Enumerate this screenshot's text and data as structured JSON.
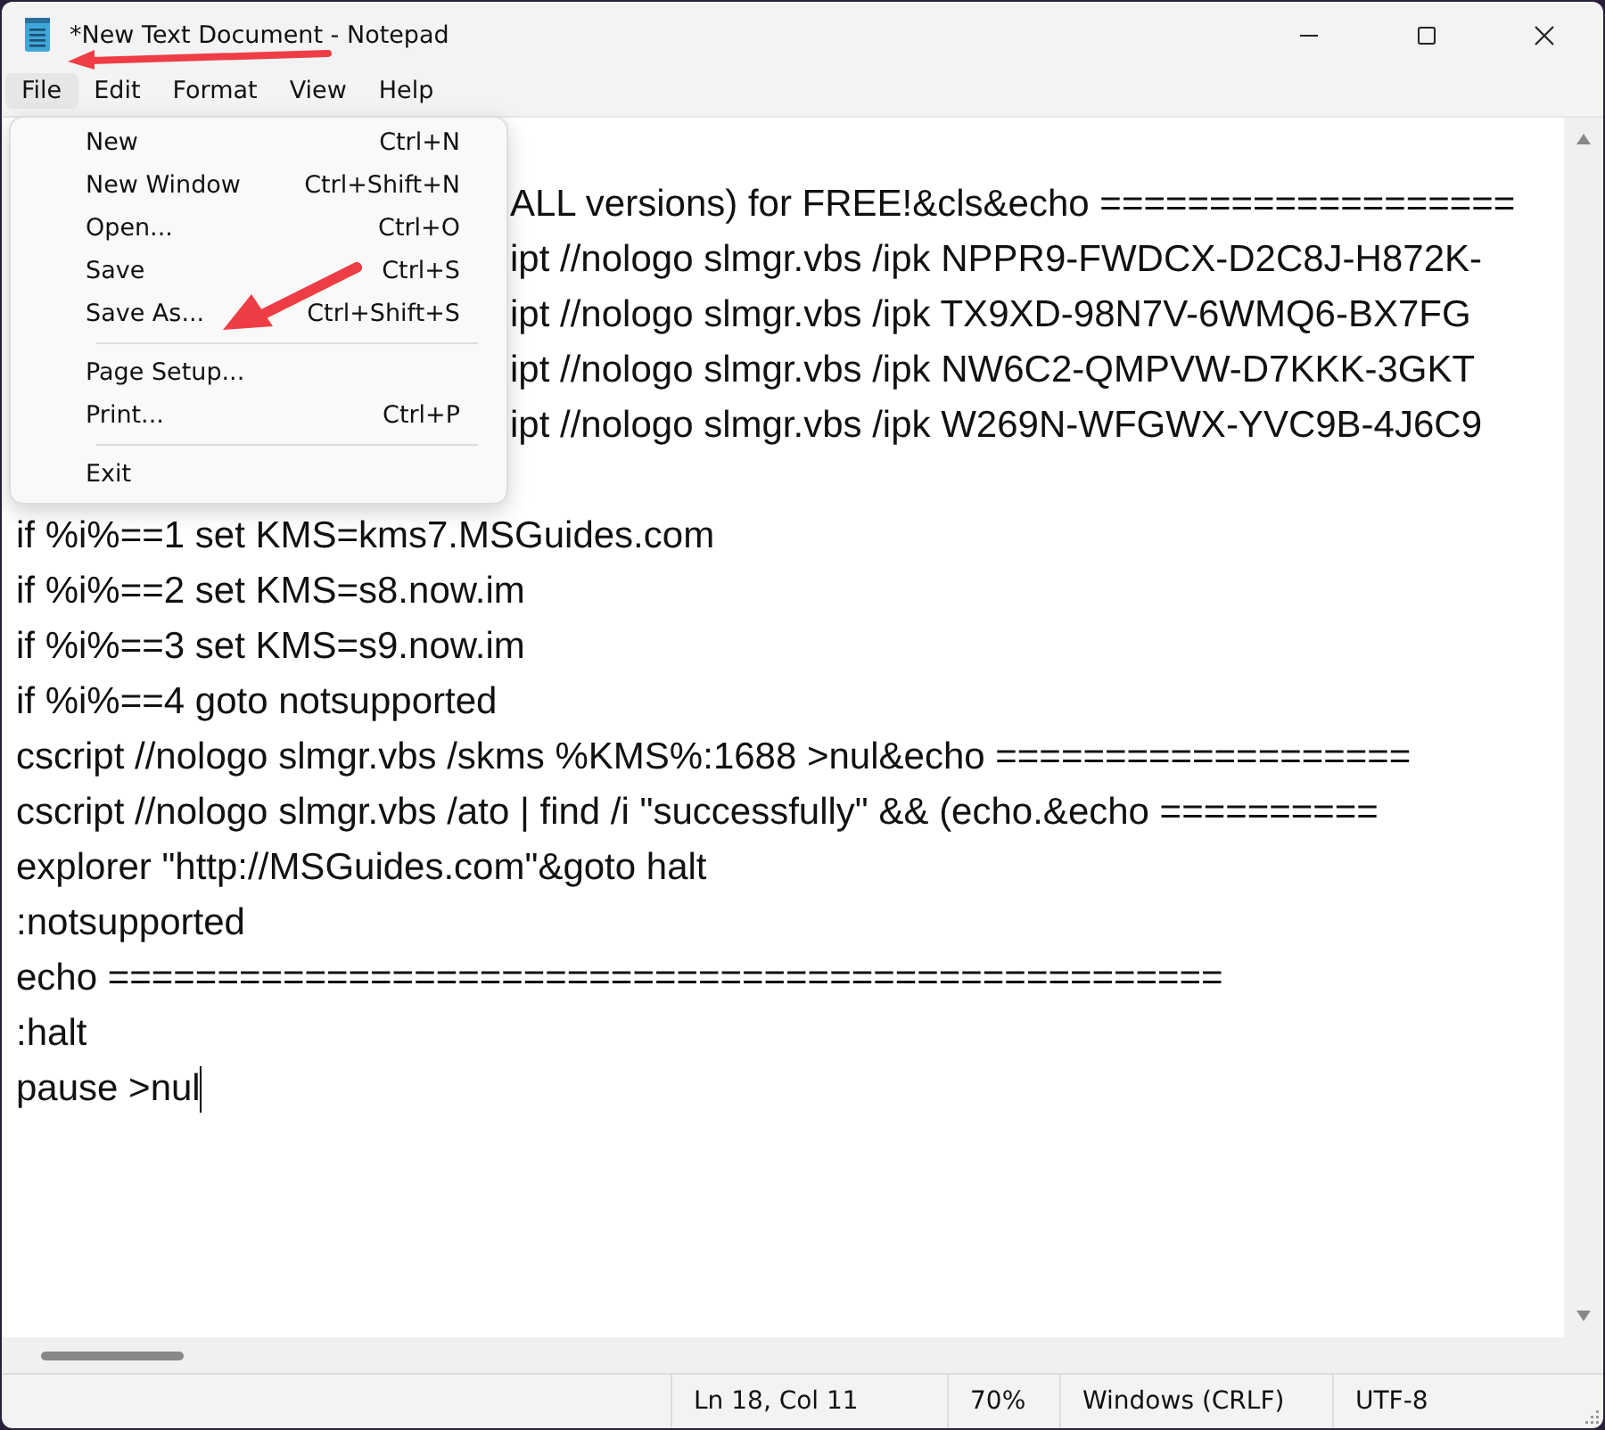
{
  "window": {
    "title": "*New Text Document - Notepad"
  },
  "menu_bar": [
    {
      "label": "File",
      "selected": true
    },
    {
      "label": "Edit",
      "selected": false
    },
    {
      "label": "Format",
      "selected": false
    },
    {
      "label": "View",
      "selected": false
    },
    {
      "label": "Help",
      "selected": false
    }
  ],
  "file_menu": [
    {
      "kind": "item",
      "label": "New",
      "shortcut": "Ctrl+N"
    },
    {
      "kind": "item",
      "label": "New Window",
      "shortcut": "Ctrl+Shift+N"
    },
    {
      "kind": "item",
      "label": "Open...",
      "shortcut": "Ctrl+O"
    },
    {
      "kind": "item",
      "label": "Save",
      "shortcut": "Ctrl+S"
    },
    {
      "kind": "item",
      "label": "Save As...",
      "shortcut": "Ctrl+Shift+S"
    },
    {
      "kind": "separator"
    },
    {
      "kind": "item",
      "label": "Page Setup..."
    },
    {
      "kind": "item",
      "label": "Print...",
      "shortcut": "Ctrl+P"
    },
    {
      "kind": "separator"
    },
    {
      "kind": "item",
      "label": "Exit"
    }
  ],
  "editor": {
    "lines_beside_menu": [
      "ALL versions) for FREE!&cls&echo ===================",
      "ipt //nologo slmgr.vbs /ipk NPPR9-FWDCX-D2C8J-H872K-",
      "ipt //nologo slmgr.vbs /ipk TX9XD-98N7V-6WMQ6-BX7FG",
      "ipt //nologo slmgr.vbs /ipk NW6C2-QMPVW-D7KKK-3GKT",
      "ipt //nologo slmgr.vbs /ipk W269N-WFGWX-YVC9B-4J6C9"
    ],
    "lines": [
      "if %i%==1 set KMS=kms7.MSGuides.com",
      "if %i%==2 set KMS=s8.now.im",
      "if %i%==3 set KMS=s9.now.im",
      "if %i%==4 goto notsupported",
      "cscript //nologo slmgr.vbs /skms %KMS%:1688 >nul&echo ===================",
      "cscript //nologo slmgr.vbs /ato | find /i \"successfully\" && (echo.&echo ==========",
      "explorer \"http://MSGuides.com\"&goto halt",
      ":notsupported",
      "echo ===================================================",
      ":halt",
      "pause >nul"
    ]
  },
  "status_bar": [
    "Ln 18, Col 11",
    "70%",
    "Windows (CRLF)",
    "UTF-8"
  ]
}
